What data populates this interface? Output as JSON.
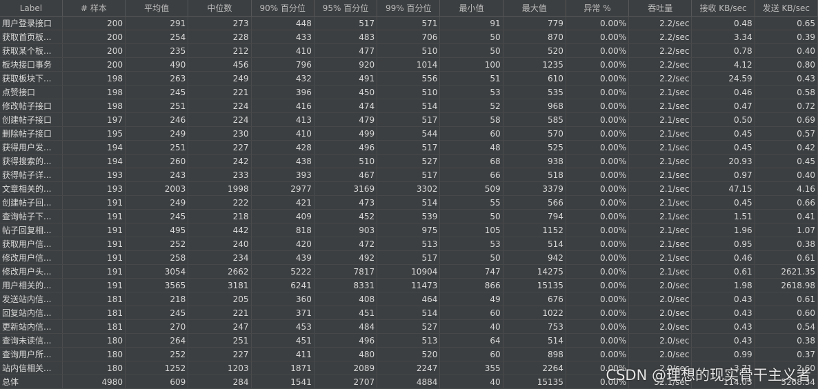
{
  "table": {
    "columns": [
      "Label",
      "# 样本",
      "平均值",
      "中位数",
      "90% 百分位",
      "95% 百分位",
      "99% 百分位",
      "最小值",
      "最大值",
      "异常 %",
      "吞吐量",
      "接收 KB/sec",
      "发送 KB/sec"
    ],
    "rows": [
      [
        "用户登录接口",
        "200",
        "291",
        "273",
        "448",
        "517",
        "571",
        "91",
        "779",
        "0.00%",
        "2.2/sec",
        "0.48",
        "0.65"
      ],
      [
        "获取首页板...",
        "200",
        "254",
        "228",
        "433",
        "483",
        "706",
        "50",
        "870",
        "0.00%",
        "2.2/sec",
        "3.34",
        "0.39"
      ],
      [
        "获取某个板...",
        "200",
        "235",
        "212",
        "410",
        "477",
        "510",
        "50",
        "520",
        "0.00%",
        "2.2/sec",
        "0.78",
        "0.40"
      ],
      [
        "板块接口事务",
        "200",
        "490",
        "456",
        "796",
        "920",
        "1014",
        "100",
        "1235",
        "0.00%",
        "2.2/sec",
        "4.12",
        "0.80"
      ],
      [
        "获取板块下...",
        "198",
        "263",
        "249",
        "432",
        "491",
        "556",
        "51",
        "610",
        "0.00%",
        "2.2/sec",
        "24.59",
        "0.43"
      ],
      [
        "点赞接口",
        "198",
        "245",
        "221",
        "396",
        "450",
        "510",
        "53",
        "535",
        "0.00%",
        "2.1/sec",
        "0.46",
        "0.58"
      ],
      [
        "修改帖子接口",
        "198",
        "251",
        "224",
        "416",
        "474",
        "514",
        "52",
        "968",
        "0.00%",
        "2.1/sec",
        "0.47",
        "0.72"
      ],
      [
        "创建帖子接口",
        "197",
        "246",
        "224",
        "413",
        "479",
        "517",
        "58",
        "585",
        "0.00%",
        "2.1/sec",
        "0.50",
        "0.69"
      ],
      [
        "删除帖子接口",
        "195",
        "249",
        "230",
        "410",
        "499",
        "544",
        "60",
        "570",
        "0.00%",
        "2.1/sec",
        "0.45",
        "0.57"
      ],
      [
        "获得用户发...",
        "194",
        "251",
        "227",
        "428",
        "496",
        "517",
        "48",
        "525",
        "0.00%",
        "2.1/sec",
        "0.45",
        "0.42"
      ],
      [
        "获得搜索的...",
        "194",
        "260",
        "242",
        "438",
        "510",
        "527",
        "68",
        "938",
        "0.00%",
        "2.1/sec",
        "20.93",
        "0.45"
      ],
      [
        "获得帖子详...",
        "193",
        "243",
        "233",
        "393",
        "467",
        "517",
        "66",
        "518",
        "0.00%",
        "2.1/sec",
        "0.97",
        "0.40"
      ],
      [
        "文章相关的...",
        "193",
        "2003",
        "1998",
        "2977",
        "3169",
        "3302",
        "509",
        "3379",
        "0.00%",
        "2.1/sec",
        "47.15",
        "4.16"
      ],
      [
        "创建帖子回...",
        "191",
        "249",
        "222",
        "421",
        "473",
        "514",
        "55",
        "566",
        "0.00%",
        "2.1/sec",
        "0.45",
        "0.66"
      ],
      [
        "查询帖子下...",
        "191",
        "245",
        "218",
        "409",
        "452",
        "539",
        "50",
        "794",
        "0.00%",
        "2.1/sec",
        "1.51",
        "0.41"
      ],
      [
        "帖子回复相...",
        "191",
        "495",
        "442",
        "818",
        "903",
        "975",
        "105",
        "1152",
        "0.00%",
        "2.1/sec",
        "1.96",
        "1.07"
      ],
      [
        "获取用户信...",
        "191",
        "252",
        "240",
        "420",
        "472",
        "513",
        "53",
        "514",
        "0.00%",
        "2.1/sec",
        "0.95",
        "0.38"
      ],
      [
        "修改用户信...",
        "191",
        "258",
        "234",
        "439",
        "492",
        "517",
        "50",
        "942",
        "0.00%",
        "2.1/sec",
        "0.46",
        "0.61"
      ],
      [
        "修改用户头...",
        "191",
        "3054",
        "2662",
        "5222",
        "7817",
        "10904",
        "747",
        "14275",
        "0.00%",
        "2.1/sec",
        "0.61",
        "2621.35"
      ],
      [
        "用户相关的...",
        "191",
        "3565",
        "3181",
        "6241",
        "8331",
        "11473",
        "866",
        "15135",
        "0.00%",
        "2.0/sec",
        "1.98",
        "2618.98"
      ],
      [
        "发送站内信...",
        "181",
        "218",
        "205",
        "360",
        "408",
        "464",
        "49",
        "676",
        "0.00%",
        "2.0/sec",
        "0.43",
        "0.61"
      ],
      [
        "回复站内信...",
        "181",
        "245",
        "221",
        "371",
        "451",
        "514",
        "60",
        "1022",
        "0.00%",
        "2.0/sec",
        "0.43",
        "0.60"
      ],
      [
        "更新站内信...",
        "181",
        "270",
        "247",
        "453",
        "484",
        "527",
        "40",
        "753",
        "0.00%",
        "2.0/sec",
        "0.43",
        "0.54"
      ],
      [
        "查询未读信...",
        "180",
        "264",
        "251",
        "451",
        "496",
        "513",
        "64",
        "514",
        "0.00%",
        "2.0/sec",
        "0.43",
        "0.38"
      ],
      [
        "查询用户所...",
        "180",
        "252",
        "227",
        "411",
        "480",
        "520",
        "60",
        "898",
        "0.00%",
        "2.0/sec",
        "0.99",
        "0.37"
      ],
      [
        "站内信相关...",
        "180",
        "1252",
        "1203",
        "1871",
        "2089",
        "2247",
        "355",
        "2264",
        "0.00%",
        "2.0/sec",
        "3.71",
        "2.60"
      ],
      [
        "总体",
        "4980",
        "609",
        "284",
        "1541",
        "2707",
        "4884",
        "40",
        "15135",
        "0.00%",
        "52.1/sec",
        "114.03",
        "5268.34"
      ]
    ]
  },
  "watermark": "CSDN @理想的现实骨干主义者"
}
